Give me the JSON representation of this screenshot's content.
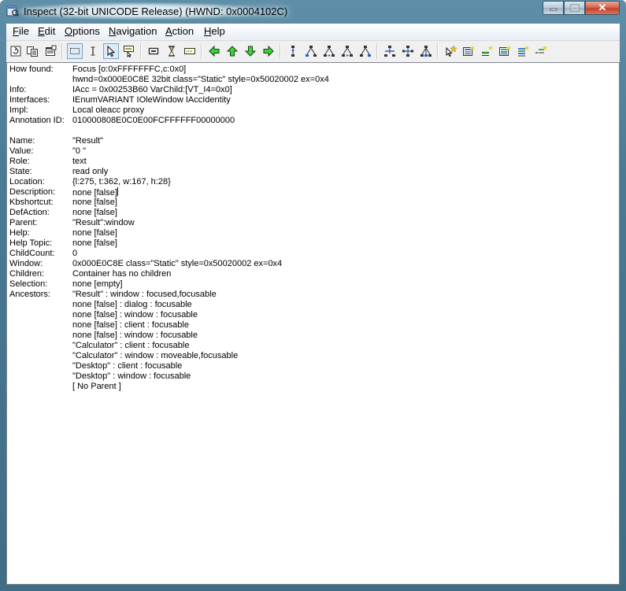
{
  "window": {
    "title": "Inspect  (32-bit UNICODE Release) (HWND: 0x0004102C)",
    "close_glyph": "✕"
  },
  "menu": [
    "File",
    "Edit",
    "Options",
    "Navigation",
    "Action",
    "Help"
  ],
  "toolbar_icons": [
    "refresh-icon",
    "copy-icon",
    "properties-icon",
    "rectangle-select-icon",
    "text-cursor-icon",
    "arrow-pointer-icon",
    "tooltip-icon",
    "highlight-rect-icon",
    "hourglass-icon",
    "caret-icon",
    "nav-left-icon",
    "nav-up-icon",
    "nav-down-icon",
    "nav-right-icon",
    "tree-parent-icon",
    "tree-first-child-icon",
    "tree-prev-sibling-icon",
    "tree-next-sibling-icon",
    "tree-last-child-icon",
    "tree-collapse-icon",
    "tree-expand-icon",
    "tree-navigate-icon",
    "default-action-icon",
    "select-icon",
    "focus-icon",
    "add-select-icon",
    "extend-select-icon",
    "remove-select-icon"
  ],
  "properties": [
    {
      "key": "How found:",
      "value": "Focus [o:0xFFFFFFFC,c:0x0]"
    },
    {
      "key": "",
      "value": "hwnd=0x000E0C8E 32bit class=\"Static\" style=0x50020002 ex=0x4"
    },
    {
      "key": "Info:",
      "value": "IAcc = 0x00253B60 VarChild:[VT_I4=0x0]"
    },
    {
      "key": "Interfaces:",
      "value": "IEnumVARIANT IOleWindow IAccIdentity"
    },
    {
      "key": "Impl:",
      "value": "Local oleacc proxy"
    },
    {
      "key": "Annotation ID:",
      "value": "010000808E0C0E00FCFFFFFF00000000"
    },
    {
      "key": "",
      "value": ""
    },
    {
      "key": "Name:",
      "value": "\"Result\""
    },
    {
      "key": "Value:",
      "value": "\"0 \""
    },
    {
      "key": "Role:",
      "value": "text"
    },
    {
      "key": "State:",
      "value": "read only"
    },
    {
      "key": "Location:",
      "value": "{l:275, t:362, w:167, h:28}"
    },
    {
      "key": "Description:",
      "value": "none [false]"
    },
    {
      "key": "Kbshortcut:",
      "value": "none [false]"
    },
    {
      "key": "DefAction:",
      "value": "none [false]"
    },
    {
      "key": "Parent:",
      "value": "\"Result\":window"
    },
    {
      "key": "Help:",
      "value": "none [false]"
    },
    {
      "key": "Help Topic:",
      "value": "none [false]"
    },
    {
      "key": "ChildCount:",
      "value": "0"
    },
    {
      "key": "Window:",
      "value": "0x000E0C8E class=\"Static\" style=0x50020002 ex=0x4"
    },
    {
      "key": "Children:",
      "value": "Container has no children"
    },
    {
      "key": "Selection:",
      "value": "none [empty]"
    },
    {
      "key": "Ancestors:",
      "value": "\"Result\" : window : focused,focusable"
    },
    {
      "key": "",
      "value": "none [false] : dialog : focusable"
    },
    {
      "key": "",
      "value": "none [false] : window : focusable"
    },
    {
      "key": "",
      "value": "none [false] : client : focusable"
    },
    {
      "key": "",
      "value": "none [false] : window : focusable"
    },
    {
      "key": "",
      "value": "\"Calculator\" : client : focusable"
    },
    {
      "key": "",
      "value": "\"Calculator\" : window : moveable,focusable"
    },
    {
      "key": "",
      "value": "\"Desktop\" : client : focusable"
    },
    {
      "key": "",
      "value": "\"Desktop\" : window : focusable"
    },
    {
      "key": "",
      "value": "[ No Parent ]"
    }
  ]
}
